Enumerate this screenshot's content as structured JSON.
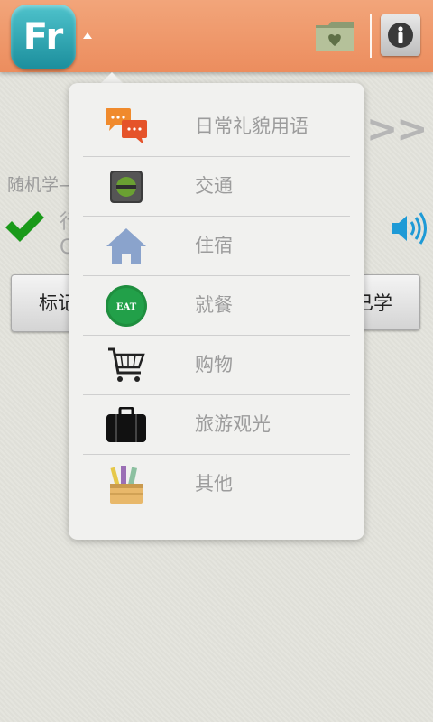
{
  "header": {
    "logo_text": "Fr",
    "icons": {
      "folder": "favorites-folder-icon",
      "info": "info-icon"
    }
  },
  "background": {
    "next_label": ">>",
    "random_label": "随机学—",
    "word_fragment": "行",
    "word_sub_fragment": "C",
    "mark_button_fragment": "标记",
    "learned_button_fragment": "已学"
  },
  "menu": {
    "items": [
      {
        "label": "日常礼貌用语",
        "icon": "chat-bubbles-icon"
      },
      {
        "label": "交通",
        "icon": "traffic-light-icon"
      },
      {
        "label": "住宿",
        "icon": "house-icon"
      },
      {
        "label": "就餐",
        "icon": "eat-icon",
        "icon_text": "EAT"
      },
      {
        "label": "购物",
        "icon": "shopping-cart-icon"
      },
      {
        "label": "旅游观光",
        "icon": "suitcase-icon"
      },
      {
        "label": "其他",
        "icon": "basket-icon"
      }
    ]
  },
  "colors": {
    "header": "#ec8d5e",
    "logo": "#1b8e9c",
    "check": "#1a9a1a",
    "speaker": "#1e9ad6",
    "menu_text": "#9c9c9c"
  }
}
